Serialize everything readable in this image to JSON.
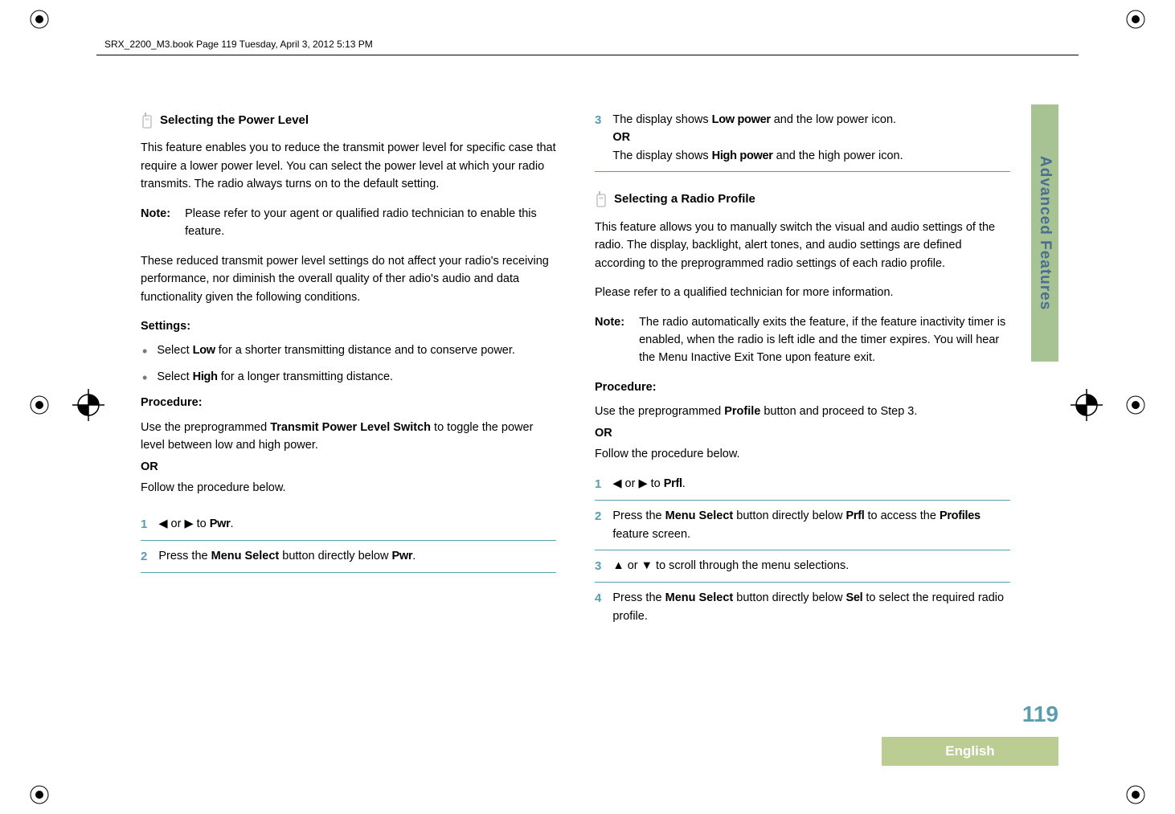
{
  "header": {
    "running_head": "SRX_2200_M3.book  Page 119  Tuesday, April 3, 2012  5:13 PM"
  },
  "side_tab": "Advanced Features",
  "page_number": "119",
  "footer_language": "English",
  "left": {
    "section_title": "Selecting the Power Level",
    "intro": "This feature enables you to reduce the transmit power level for specific case that require a lower power level. You can select the power level at which your radio transmits. The radio always turns on to the default setting.",
    "note_label": "Note:",
    "note_text": "Please refer to your agent or qualified radio technician to enable this feature.",
    "para2": "These reduced transmit power level settings do not affect your radio's receiving performance, nor diminish the overall quality of ther adio's audio and data functionality given the following conditions.",
    "settings_label": "Settings:",
    "bullet1_pre": "Select ",
    "bullet1_val": "Low",
    "bullet1_post": " for a shorter transmitting distance and to conserve power.",
    "bullet2_pre": "Select ",
    "bullet2_val": "High",
    "bullet2_post": " for a longer transmitting distance.",
    "procedure_label": "Procedure:",
    "proc_line1_pre": "Use the preprogrammed ",
    "proc_line1_bold": "Transmit Power Level Switch",
    "proc_line1_post": " to toggle the power level between low and high power.",
    "or_label": "OR",
    "proc_follow": "Follow the procedure below.",
    "step1_num": "1",
    "step1_mid": " or ",
    "step1_to": " to ",
    "step1_val": "Pwr",
    "step1_end": ".",
    "step2_num": "2",
    "step2_pre": "Press the ",
    "step2_bold": "Menu Select",
    "step2_mid": " button directly below ",
    "step2_val": "Pwr",
    "step2_end": "."
  },
  "right": {
    "step3_num": "3",
    "step3_pre": "The display shows ",
    "step3_val1": "Low power",
    "step3_mid": " and the low power icon.",
    "step3_or": "OR",
    "step3_pre2": "The display shows ",
    "step3_val2": "High power",
    "step3_post2": " and the high power icon.",
    "section_title": "Selecting a Radio Profile",
    "intro": "This feature allows you to manually switch the visual and audio settings of the radio. The display, backlight, alert tones, and audio settings are defined according to the preprogrammed radio settings of each radio profile.",
    "para2": "Please refer to a qualified technician for more information.",
    "note_label": "Note:",
    "note_text": "The radio automatically exits the feature, if the feature inactivity timer is enabled, when the radio is left idle and the timer expires. You will hear the Menu Inactive Exit Tone upon feature exit.",
    "procedure_label": "Procedure:",
    "proc_line1_pre": "Use the preprogrammed ",
    "proc_line1_bold": "Profile",
    "proc_line1_post": " button and proceed to Step 3.",
    "or_label": "OR",
    "proc_follow": "Follow the procedure below.",
    "step1_num": "1",
    "step1_mid": " or ",
    "step1_to": " to ",
    "step1_val": "Prfl",
    "step1_end": ".",
    "step2_num": "2",
    "step2_pre": "Press the ",
    "step2_bold": "Menu Select",
    "step2_mid": " button directly below ",
    "step2_val": "Prfl",
    "step2_mid2": " to access the ",
    "step2_val2": "Profiles",
    "step2_end": " feature screen.",
    "step3b_num": "3",
    "step3b_mid": " or ",
    "step3b_post": " to scroll through the menu selections.",
    "step4_num": "4",
    "step4_pre": "Press the ",
    "step4_bold": "Menu Select",
    "step4_mid": " button directly below ",
    "step4_val": "Sel",
    "step4_post": " to select the required radio profile."
  }
}
